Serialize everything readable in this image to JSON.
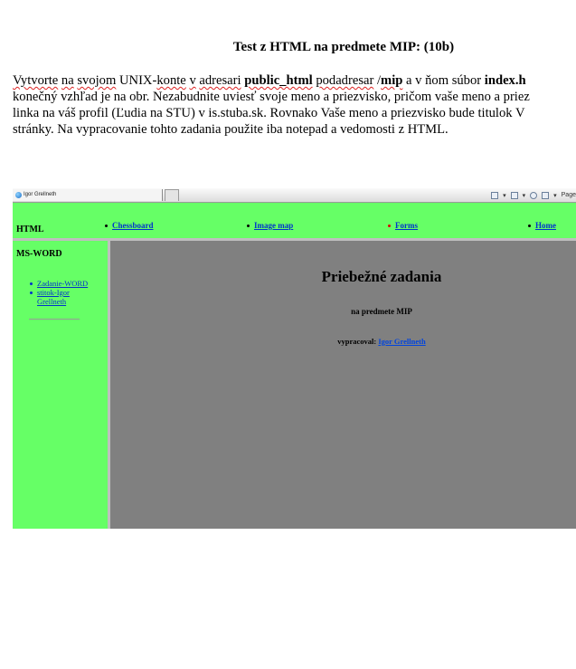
{
  "document": {
    "title": "Test z HTML na predmete MIP: (10b)",
    "paragraph": {
      "line1": [
        {
          "text": "Vytvorte",
          "bold": false,
          "squiggle": true
        },
        {
          "text": " ",
          "bold": false,
          "squiggle": false
        },
        {
          "text": "na",
          "bold": false,
          "squiggle": true
        },
        {
          "text": " ",
          "bold": false,
          "squiggle": false
        },
        {
          "text": "svojom",
          "bold": false,
          "squiggle": true
        },
        {
          "text": " UNIX-",
          "bold": false,
          "squiggle": false
        },
        {
          "text": "konte",
          "bold": false,
          "squiggle": true
        },
        {
          "text": " ",
          "bold": false,
          "squiggle": false
        },
        {
          "text": "v",
          "bold": false,
          "squiggle": true
        },
        {
          "text": " ",
          "bold": false,
          "squiggle": false
        },
        {
          "text": "adresari",
          "bold": false,
          "squiggle": true
        },
        {
          "text": " ",
          "bold": false,
          "squiggle": false
        },
        {
          "text": "public_html",
          "bold": true,
          "squiggle": true
        },
        {
          "text": " ",
          "bold": false,
          "squiggle": false
        },
        {
          "text": "podadresar",
          "bold": false,
          "squiggle": true
        },
        {
          "text": " /",
          "bold": false,
          "squiggle": false
        },
        {
          "text": "mip",
          "bold": true,
          "squiggle": true
        },
        {
          "text": " a v ňom súbor ",
          "bold": false,
          "squiggle": false
        },
        {
          "text": "index.h",
          "bold": true,
          "squiggle": false
        }
      ],
      "line2": "konečný vzhľad je na obr. Nezabudnite uviesť svoje meno a priezvisko, pričom vaše meno a priez",
      "line3": "linka na váš profil (Ľudia na STU) v is.stuba.sk. Rovnako Vaše meno a priezvisko bude titulok V",
      "line4": "stránky. Na vypracovanie tohto zadania použite iba notepad a vedomosti z HTML."
    }
  },
  "screenshot": {
    "browser": {
      "tab_title": "Igor Grellneth",
      "tools_label": "Page"
    },
    "top_nav": {
      "title": "HTML",
      "items": [
        {
          "label": "Chessboard",
          "bullet_color": "#000000"
        },
        {
          "label": "Image map",
          "bullet_color": "#000000"
        },
        {
          "label": "Forms",
          "bullet_color": "#dd0000"
        },
        {
          "label": "Home",
          "bullet_color": "#000000"
        }
      ]
    },
    "left_panel": {
      "title": "MS-WORD",
      "links": [
        "Zadanie-WORD",
        "stitok-Igor Grellneth"
      ]
    },
    "main": {
      "title": "Priebežné zadania",
      "subtitle": "na predmete MIP",
      "author_prefix": "vypracoval:",
      "author_name": "Igor Grellneth"
    },
    "colors": {
      "green": "#66ff66",
      "gray": "#808080",
      "link": "#0033cc"
    }
  }
}
